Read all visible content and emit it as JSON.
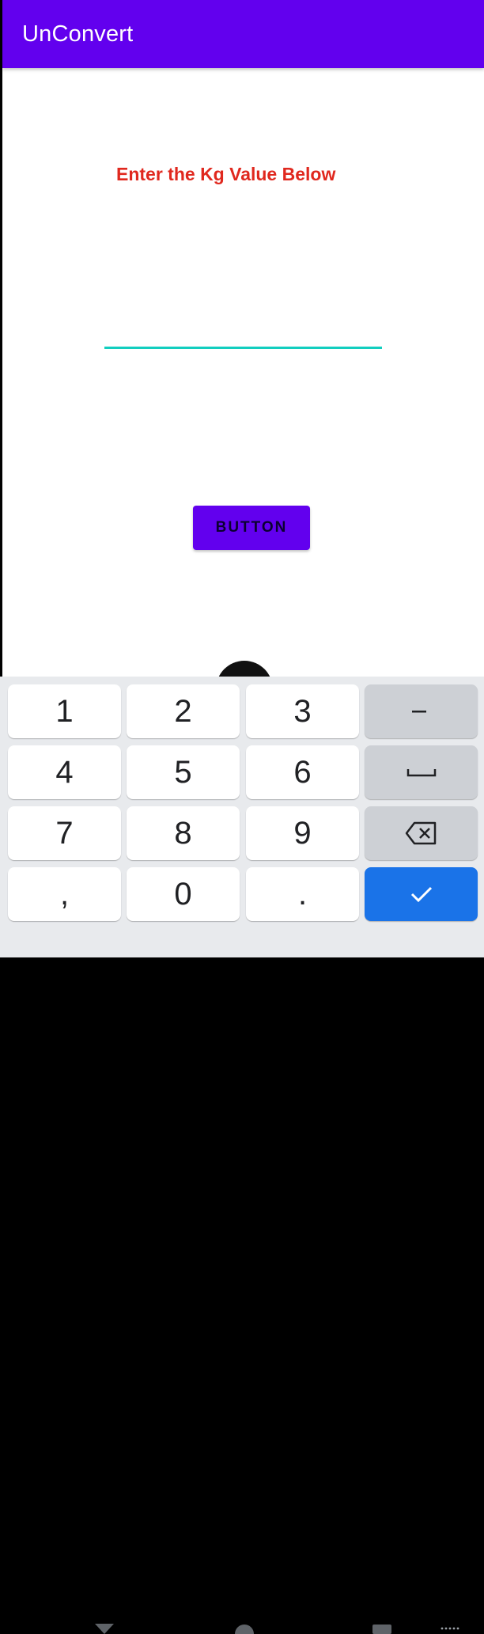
{
  "app": {
    "title": "UnConvert"
  },
  "main": {
    "prompt": "Enter the Kg Value Below",
    "input_value": "",
    "button_label": "BUTTON"
  },
  "keyboard": {
    "keys": {
      "k1": "1",
      "k2": "2",
      "k3": "3",
      "k4": "4",
      "k5": "5",
      "k6": "6",
      "k7": "7",
      "k8": "8",
      "k9": "9",
      "comma": ",",
      "k0": "0",
      "period": "."
    },
    "function_keys": {
      "minus": "minus-icon",
      "space": "space-icon",
      "backspace": "backspace-icon",
      "done": "check-icon"
    }
  },
  "colors": {
    "primary": "#6200EE",
    "prompt_text": "#E0281E",
    "input_underline": "#12CEBF",
    "keyboard_done": "#1A73E8"
  }
}
